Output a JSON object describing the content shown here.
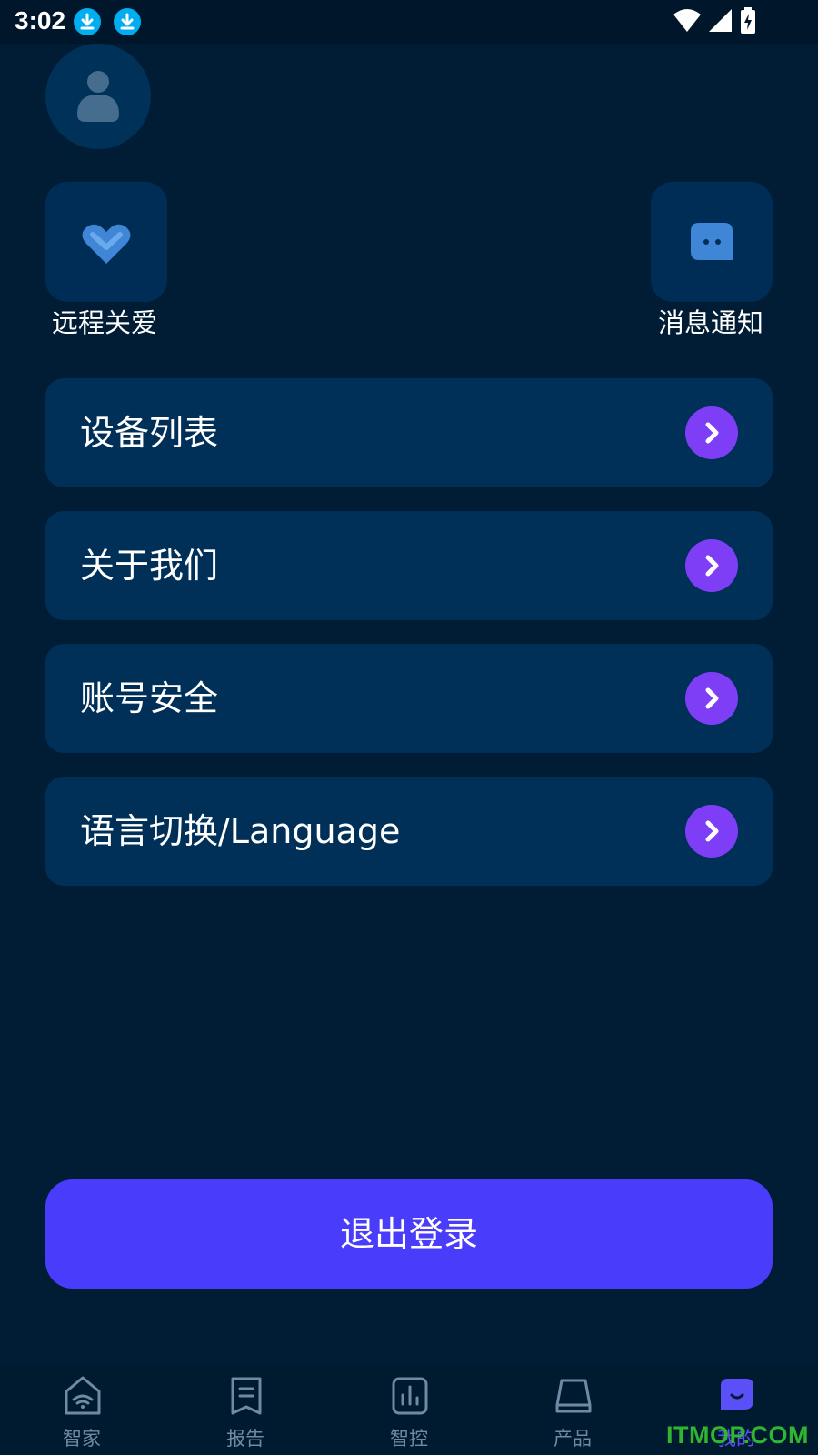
{
  "status_bar": {
    "time": "3:02",
    "left_icons": [
      "download-icon",
      "download-icon"
    ],
    "right_icons": [
      "wifi-icon",
      "signal-icon",
      "battery-charging-icon"
    ]
  },
  "profile": {
    "avatar_icon": "user-icon"
  },
  "quick_actions": [
    {
      "label": "远程关爱",
      "icon": "heart-handshake-icon"
    },
    {
      "label": "消息通知",
      "icon": "chat-bubble-icon"
    }
  ],
  "menu": [
    {
      "label": "设备列表"
    },
    {
      "label": "关于我们"
    },
    {
      "label": "账号安全"
    },
    {
      "label": "语言切换/Language"
    }
  ],
  "logout_label": "退出登录",
  "bottom_nav": [
    {
      "label": "智家",
      "icon": "home-wifi-icon",
      "active": false
    },
    {
      "label": "报告",
      "icon": "report-icon",
      "active": false
    },
    {
      "label": "智控",
      "icon": "chart-icon",
      "active": false
    },
    {
      "label": "产品",
      "icon": "product-icon",
      "active": false
    },
    {
      "label": "我的",
      "icon": "profile-smile-icon",
      "active": true
    }
  ],
  "watermark": "ITMOP.COM",
  "colors": {
    "background": "#001d35",
    "card": "#003058",
    "accent_purple": "#7e3ef6",
    "logout_button": "#4a3cfb",
    "nav_inactive": "#6f8aa4",
    "nav_active": "#5b4ff7"
  }
}
